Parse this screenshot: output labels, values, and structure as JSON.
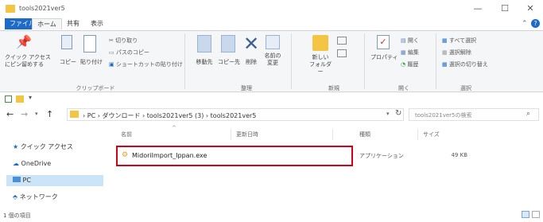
{
  "window": {
    "title": "tools2021ver5",
    "controls": {
      "minimize": "—",
      "maximize": "☐",
      "close": "✕"
    }
  },
  "menu": {
    "tabs": [
      "ファイル",
      "ホーム",
      "共有",
      "表示"
    ],
    "active_tab": "ホーム"
  },
  "ribbon": {
    "clipboard": {
      "pin_label_1": "クイック アクセス",
      "pin_label_2": "にピン留めする",
      "copy_label": "コピー",
      "paste_label": "貼り付け",
      "cut": "切り取り",
      "copy_path": "パスのコピー",
      "paste_shortcut": "ショートカットの貼り付け",
      "group": "クリップボード"
    },
    "organize": {
      "move_to": "移動先",
      "copy_to": "コピー先",
      "delete": "削除",
      "rename_1": "名前の",
      "rename_2": "変更",
      "group": "整理"
    },
    "new": {
      "new_folder_1": "新しい",
      "new_folder_2": "フォルダー",
      "group": "新規"
    },
    "open": {
      "properties": "プロパティ",
      "open": "開く",
      "edit": "編集",
      "history": "履歴",
      "group": "開く"
    },
    "select": {
      "select_all": "すべて選択",
      "select_none": "選択解除",
      "invert": "選択の切り替え",
      "group": "選択"
    }
  },
  "address": {
    "back": "←",
    "forward": "→",
    "up": "↑",
    "path": [
      "PC",
      "ダウンロード",
      "tools2021ver5 (3)",
      "tools2021ver5"
    ],
    "refresh": "↻",
    "search_placeholder": "tools2021ver5の検索"
  },
  "nav": {
    "items": [
      "クイック アクセス",
      "OneDrive",
      "PC",
      "ネットワーク"
    ],
    "selected": "PC"
  },
  "columns": {
    "name": "名前",
    "date": "更新日時",
    "type": "種類",
    "size": "サイズ"
  },
  "files": [
    {
      "name": "MidoriImport_Ippan.exe",
      "date": "",
      "type": "アプリケーション",
      "size": "49 KB"
    }
  ],
  "status": {
    "count": "1 個の項目"
  },
  "colors": {
    "accent": "#1e6ac8",
    "highlight_box": "#d0021b",
    "selected_nav": "#cce4f7"
  }
}
